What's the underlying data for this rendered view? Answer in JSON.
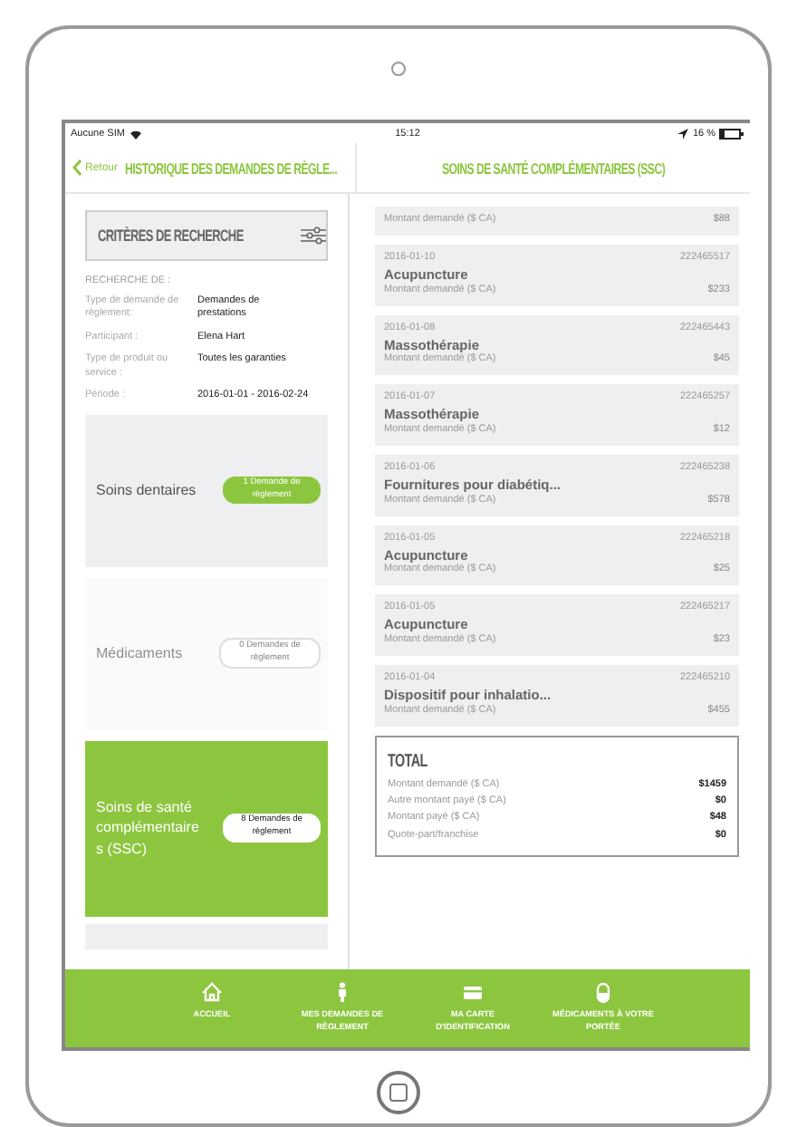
{
  "status_bar": {
    "carrier": "Aucune SIM",
    "time": "15:12",
    "battery": "16 %"
  },
  "nav": {
    "back": "Retour",
    "left_title": "HISTORIQUE DES DEMANDES DE RÈGLE...",
    "right_title": "SOINS DE SANTÉ COMPLÉMENTAIRES (SSC)"
  },
  "criteria": {
    "title": "CRITÈRES DE RECHERCHE",
    "heading": "RECHERCHE DE :",
    "fields": [
      {
        "label": "Type de demande de règlement:",
        "value": "Demandes de prestations"
      },
      {
        "label": "Participant :",
        "value": "Elena Hart"
      },
      {
        "label": "Type de produit ou service :",
        "value": "Toutes les garanties"
      },
      {
        "label": "Période :",
        "value": "2016-01-01 - 2016-02-24"
      }
    ]
  },
  "categories": [
    {
      "name": "Soins dentaires",
      "count": "1 Demande de règlement",
      "selected": false,
      "disabled": false
    },
    {
      "name": "Médicaments",
      "count": "0 Demandes de règlement",
      "selected": false,
      "disabled": true
    },
    {
      "name": "Soins de santé complémentaires (SSC)",
      "count": "8 Demandes de règlement",
      "selected": true,
      "disabled": false
    }
  ],
  "claims": [
    {
      "amount_label": "Montant demandé ($ CA)",
      "amount": "$88"
    },
    {
      "date": "2016-01-10",
      "number": "222465517",
      "service": "Acupuncture",
      "amount_label": "Montant demandé ($ CA)",
      "amount": "$233"
    },
    {
      "date": "2016-01-08",
      "number": "222465443",
      "service": "Massothérapie",
      "amount_label": "Montant demandé ($ CA)",
      "amount": "$45"
    },
    {
      "date": "2016-01-07",
      "number": "222465257",
      "service": "Massothérapie",
      "amount_label": "Montant demandé ($ CA)",
      "amount": "$12"
    },
    {
      "date": "2016-01-06",
      "number": "222465238",
      "service": "Fournitures pour diabétiq...",
      "amount_label": "Montant demandé ($ CA)",
      "amount": "$578"
    },
    {
      "date": "2016-01-05",
      "number": "222465218",
      "service": "Acupuncture",
      "amount_label": "Montant demandé ($ CA)",
      "amount": "$25"
    },
    {
      "date": "2016-01-05",
      "number": "222465217",
      "service": "Acupuncture",
      "amount_label": "Montant demandé ($ CA)",
      "amount": "$23"
    },
    {
      "date": "2016-01-04",
      "number": "222465210",
      "service": "Dispositif pour inhalatio...",
      "amount_label": "Montant demandé ($ CA)",
      "amount": "$455"
    }
  ],
  "total": {
    "title": "TOTAL",
    "rows": [
      {
        "label": "Montant demandé ($ CA)",
        "value": "$1459"
      },
      {
        "label": "Autre montant payé ($ CA)",
        "value": "$0"
      },
      {
        "label": "Montant payé ($ CA)",
        "value": "$48"
      },
      {
        "label": "Quote-part/franchise",
        "value": "$0"
      }
    ]
  },
  "tabs": [
    {
      "kind": "home",
      "label": "ACCUEIL"
    },
    {
      "kind": "person",
      "label": "MES DEMANDES DE RÈGLEMENT"
    },
    {
      "kind": "card",
      "label": "MA CARTE D'IDENTIFICATION"
    },
    {
      "kind": "pill",
      "label": "MÉDICAMENTS À VOTRE PORTÉE"
    }
  ]
}
